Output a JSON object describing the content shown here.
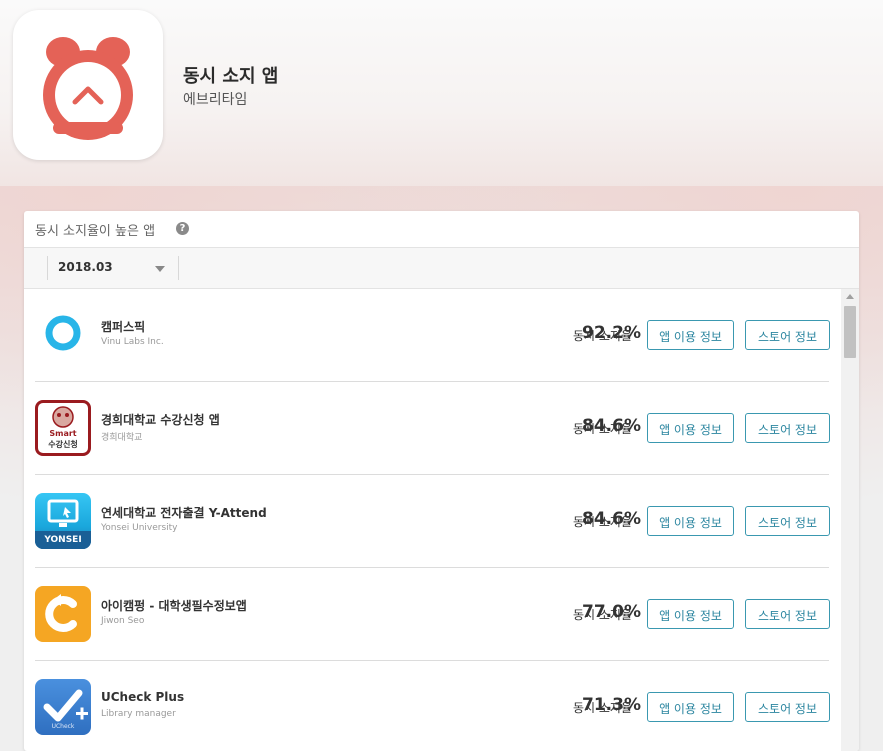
{
  "app": {
    "title": "동시 소지 앱",
    "developer": "에브리타임",
    "logo_color": "#e46257",
    "logo_icon": "alarm-clock-icon"
  },
  "panel": {
    "title": "동시 소지율이 높은 앱",
    "help_icon": "?",
    "period": "2018.03"
  },
  "rows": [
    {
      "name": "캠퍼스픽",
      "developer": "Vinu Labs Inc.",
      "label": "동시 소지율",
      "percent": "92.2%",
      "info_btn": "앱 이용 정보",
      "store_btn": "스토어 정보"
    },
    {
      "name": "경희대학교 수강신청 앱",
      "developer": "경희대학교",
      "label": "동시 소지율",
      "percent": "84.6%",
      "info_btn": "앱 이용 정보",
      "store_btn": "스토어 정보",
      "icon_text": [
        "Smart",
        "수강신청"
      ]
    },
    {
      "name": "연세대학교 전자출결 Y-Attend",
      "developer": "Yonsei University",
      "label": "동시 소지율",
      "percent": "84.6%",
      "info_btn": "앱 이용 정보",
      "store_btn": "스토어 정보",
      "icon_text": "YONSEI"
    },
    {
      "name": "아이캠펑 - 대학생필수정보앱",
      "developer": "Jiwon Seo",
      "label": "동시 소지율",
      "percent": "77.0%",
      "info_btn": "앱 이용 정보",
      "store_btn": "스토어 정보"
    },
    {
      "name": "UCheck Plus",
      "developer": "Library manager",
      "label": "동시 소지율",
      "percent": "71.3%",
      "info_btn": "앱 이용 정보",
      "store_btn": "스토어 정보",
      "icon_text": "UCheck"
    }
  ],
  "colors": {
    "accent": "#2c86a0",
    "campuspick": "#28b5e8",
    "khu": "#9a1b1f",
    "yonsei": "#1aa7dc",
    "icampung": "#f5a623",
    "ucheck": "#3b7ed0"
  }
}
